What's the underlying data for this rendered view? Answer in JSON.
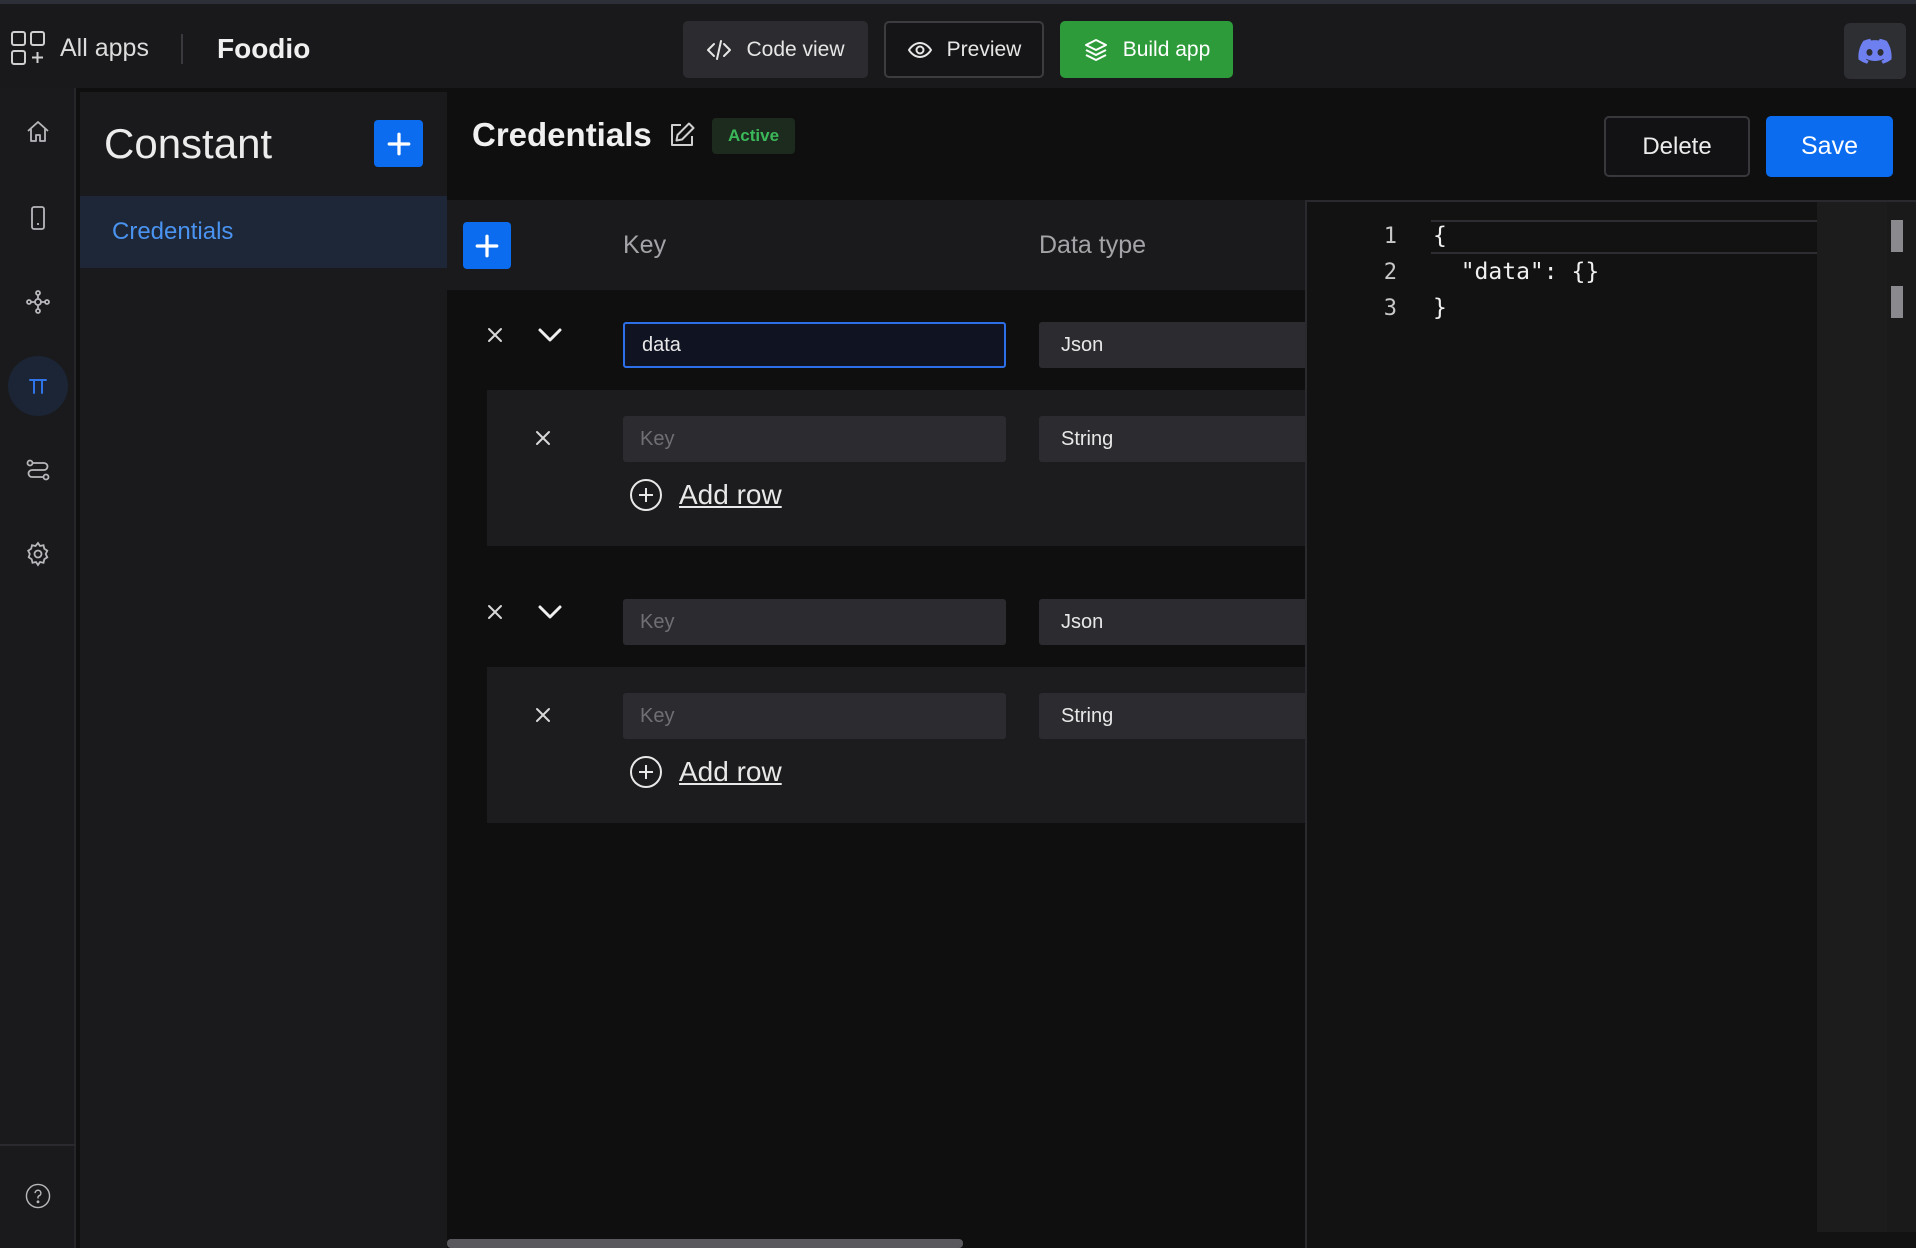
{
  "topbar": {
    "all_apps": "All apps",
    "app_name": "Foodio",
    "code_view": "Code view",
    "preview": "Preview",
    "build_app": "Build app"
  },
  "rail": {
    "icons": [
      "home-icon",
      "mobile-icon",
      "components-icon",
      "constant-icon",
      "flows-icon",
      "settings-icon",
      "help-icon"
    ],
    "active": "constant-icon"
  },
  "constants": {
    "title": "Constant",
    "items": [
      {
        "label": "Credentials",
        "selected": true
      }
    ]
  },
  "main": {
    "title": "Credentials",
    "status": "Active",
    "delete": "Delete",
    "save": "Save"
  },
  "table": {
    "columns": {
      "key": "Key",
      "data_type": "Data type"
    },
    "rows": [
      {
        "key_value": "data",
        "key_placeholder": "Key",
        "data_type": "Json",
        "children": [
          {
            "key_value": "",
            "key_placeholder": "Key",
            "data_type": "String"
          }
        ],
        "add_row": "Add row"
      },
      {
        "key_value": "",
        "key_placeholder": "Key",
        "data_type": "Json",
        "children": [
          {
            "key_value": "",
            "key_placeholder": "Key",
            "data_type": "String"
          }
        ],
        "add_row": "Add row"
      }
    ]
  },
  "editor": {
    "line_numbers": [
      "1",
      "2",
      "3"
    ],
    "lines": [
      "{",
      "  \"data\": {}",
      "}"
    ]
  },
  "colors": {
    "accent": "#0b6cf0",
    "build": "#2e9b3a",
    "active_badge": "#3bb85a",
    "selected_item": "#4a93f0"
  }
}
